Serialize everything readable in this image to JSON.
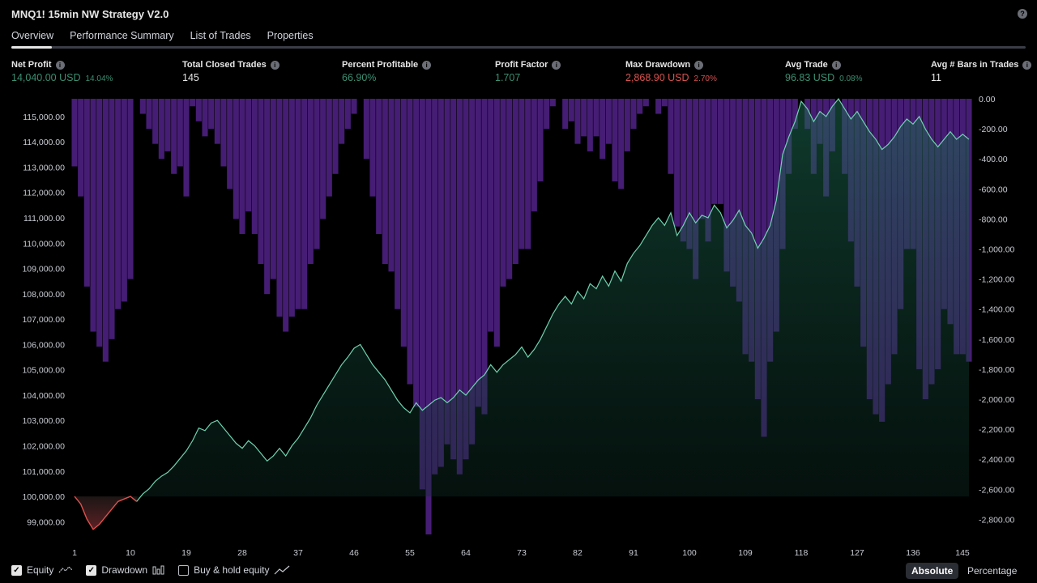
{
  "title": "MNQ1! 15min NW Strategy V2.0",
  "tabs": [
    "Overview",
    "Performance Summary",
    "List of Trades",
    "Properties"
  ],
  "stats": [
    {
      "label": "Net Profit",
      "value": "14,040.00 USD",
      "sub": "14.04%",
      "tone": "green"
    },
    {
      "label": "Total Closed Trades",
      "value": "145",
      "sub": "",
      "tone": "white"
    },
    {
      "label": "Percent Profitable",
      "value": "66.90%",
      "sub": "",
      "tone": "green"
    },
    {
      "label": "Profit Factor",
      "value": "1.707",
      "sub": "",
      "tone": "green"
    },
    {
      "label": "Max Drawdown",
      "value": "2,868.90 USD",
      "sub": "2.70%",
      "tone": "red"
    },
    {
      "label": "Avg Trade",
      "value": "96.83 USD",
      "sub": "0.08%",
      "tone": "green"
    },
    {
      "label": "Avg # Bars in Trades",
      "value": "11",
      "sub": "",
      "tone": "white"
    }
  ],
  "legend": {
    "equity": "Equity",
    "drawdown": "Drawdown",
    "buyhold": "Buy & hold equity"
  },
  "modes": {
    "absolute": "Absolute",
    "percentage": "Percentage"
  },
  "colors": {
    "equity_up": "#6fd3b0",
    "equity_down": "#e0524f",
    "drawdown_bar": "#4a1f7a",
    "accent": "#3c8f72",
    "negative": "#d9524f"
  },
  "chart_data": {
    "type": "area",
    "x_ticks": [
      1,
      10,
      19,
      28,
      37,
      46,
      55,
      64,
      73,
      82,
      91,
      100,
      109,
      118,
      127,
      136,
      145
    ],
    "left_axis": {
      "ylim": [
        98500,
        115700
      ],
      "ticks": [
        "115,000.00",
        "114,000.00",
        "113,000.00",
        "112,000.00",
        "111,000.00",
        "110,000.00",
        "109,000.00",
        "108,000.00",
        "107,000.00",
        "106,000.00",
        "105,000.00",
        "104,000.00",
        "103,000.00",
        "102,000.00",
        "101,000.00",
        "100,000.00",
        "99,000.00"
      ]
    },
    "right_axis": {
      "ylim": [
        -2900,
        0
      ],
      "ticks": [
        "0.00",
        "-200.00",
        "-400.00",
        "-600.00",
        "-800.00",
        "-1,000.00",
        "-1,200.00",
        "-1,400.00",
        "-1,600.00",
        "-1,800.00",
        "-2,000.00",
        "-2,200.00",
        "-2,400.00",
        "-2,600.00",
        "-2,800.00"
      ]
    },
    "baseline": 100000,
    "series": [
      {
        "name": "Equity",
        "points": [
          [
            1,
            100000
          ],
          [
            2,
            99700
          ],
          [
            3,
            99100
          ],
          [
            4,
            98700
          ],
          [
            5,
            98900
          ],
          [
            6,
            99200
          ],
          [
            7,
            99500
          ],
          [
            8,
            99800
          ],
          [
            9,
            99900
          ],
          [
            10,
            100000
          ],
          [
            11,
            99800
          ],
          [
            12,
            100100
          ],
          [
            13,
            100300
          ],
          [
            14,
            100600
          ],
          [
            15,
            100800
          ],
          [
            16,
            100950
          ],
          [
            17,
            101200
          ],
          [
            18,
            101500
          ],
          [
            19,
            101800
          ],
          [
            20,
            102200
          ],
          [
            21,
            102700
          ],
          [
            22,
            102600
          ],
          [
            23,
            102900
          ],
          [
            24,
            103000
          ],
          [
            25,
            102700
          ],
          [
            26,
            102400
          ],
          [
            27,
            102100
          ],
          [
            28,
            101900
          ],
          [
            29,
            102200
          ],
          [
            30,
            102000
          ],
          [
            31,
            101700
          ],
          [
            32,
            101400
          ],
          [
            33,
            101600
          ],
          [
            34,
            101900
          ],
          [
            35,
            101600
          ],
          [
            36,
            102000
          ],
          [
            37,
            102300
          ],
          [
            38,
            102700
          ],
          [
            39,
            103100
          ],
          [
            40,
            103600
          ],
          [
            41,
            104000
          ],
          [
            42,
            104400
          ],
          [
            43,
            104800
          ],
          [
            44,
            105200
          ],
          [
            45,
            105500
          ],
          [
            46,
            105850
          ],
          [
            47,
            106000
          ],
          [
            48,
            105600
          ],
          [
            49,
            105200
          ],
          [
            50,
            104900
          ],
          [
            51,
            104600
          ],
          [
            52,
            104200
          ],
          [
            53,
            103800
          ],
          [
            54,
            103500
          ],
          [
            55,
            103300
          ],
          [
            56,
            103700
          ],
          [
            57,
            103400
          ],
          [
            58,
            103600
          ],
          [
            59,
            103800
          ],
          [
            60,
            103900
          ],
          [
            61,
            103700
          ],
          [
            62,
            103900
          ],
          [
            63,
            104200
          ],
          [
            64,
            104000
          ],
          [
            65,
            104300
          ],
          [
            66,
            104600
          ],
          [
            67,
            104800
          ],
          [
            68,
            105200
          ],
          [
            69,
            104900
          ],
          [
            70,
            105200
          ],
          [
            71,
            105400
          ],
          [
            72,
            105600
          ],
          [
            73,
            105900
          ],
          [
            74,
            105500
          ],
          [
            75,
            105800
          ],
          [
            76,
            106200
          ],
          [
            77,
            106700
          ],
          [
            78,
            107200
          ],
          [
            79,
            107600
          ],
          [
            80,
            107900
          ],
          [
            81,
            107600
          ],
          [
            82,
            108100
          ],
          [
            83,
            107800
          ],
          [
            84,
            108400
          ],
          [
            85,
            108200
          ],
          [
            86,
            108700
          ],
          [
            87,
            108300
          ],
          [
            88,
            108900
          ],
          [
            89,
            108500
          ],
          [
            90,
            109200
          ],
          [
            91,
            109600
          ],
          [
            92,
            109900
          ],
          [
            93,
            110300
          ],
          [
            94,
            110700
          ],
          [
            95,
            111000
          ],
          [
            96,
            110700
          ],
          [
            97,
            111200
          ],
          [
            98,
            110300
          ],
          [
            99,
            110700
          ],
          [
            100,
            111200
          ],
          [
            101,
            110800
          ],
          [
            102,
            111100
          ],
          [
            103,
            111000
          ],
          [
            104,
            111500
          ],
          [
            105,
            111200
          ],
          [
            106,
            110600
          ],
          [
            107,
            110900
          ],
          [
            108,
            111300
          ],
          [
            109,
            110700
          ],
          [
            110,
            110400
          ],
          [
            111,
            109800
          ],
          [
            112,
            110200
          ],
          [
            113,
            110700
          ],
          [
            114,
            111700
          ],
          [
            115,
            113500
          ],
          [
            116,
            114200
          ],
          [
            117,
            114800
          ],
          [
            118,
            115600
          ],
          [
            119,
            115300
          ],
          [
            120,
            114800
          ],
          [
            121,
            115200
          ],
          [
            122,
            115000
          ],
          [
            123,
            115400
          ],
          [
            124,
            115700
          ],
          [
            125,
            115300
          ],
          [
            126,
            114900
          ],
          [
            127,
            115200
          ],
          [
            128,
            114800
          ],
          [
            129,
            114400
          ],
          [
            130,
            114100
          ],
          [
            131,
            113700
          ],
          [
            132,
            113900
          ],
          [
            133,
            114200
          ],
          [
            134,
            114600
          ],
          [
            135,
            114900
          ],
          [
            136,
            114700
          ],
          [
            137,
            115000
          ],
          [
            138,
            114500
          ],
          [
            139,
            114100
          ],
          [
            140,
            113800
          ],
          [
            141,
            114100
          ],
          [
            142,
            114400
          ],
          [
            143,
            114100
          ],
          [
            144,
            114300
          ],
          [
            145,
            114100
          ]
        ]
      },
      {
        "name": "Drawdown",
        "points": [
          [
            1,
            -450
          ],
          [
            2,
            -650
          ],
          [
            3,
            -1250
          ],
          [
            4,
            -1550
          ],
          [
            5,
            -1650
          ],
          [
            6,
            -1750
          ],
          [
            7,
            -1600
          ],
          [
            8,
            -1400
          ],
          [
            9,
            -1350
          ],
          [
            10,
            -1200
          ],
          [
            11,
            0
          ],
          [
            12,
            -100
          ],
          [
            13,
            -200
          ],
          [
            14,
            -300
          ],
          [
            15,
            -400
          ],
          [
            16,
            -350
          ],
          [
            17,
            -500
          ],
          [
            18,
            -450
          ],
          [
            19,
            -650
          ],
          [
            20,
            -50
          ],
          [
            21,
            -150
          ],
          [
            22,
            -250
          ],
          [
            23,
            -200
          ],
          [
            24,
            -300
          ],
          [
            25,
            -450
          ],
          [
            26,
            -600
          ],
          [
            27,
            -800
          ],
          [
            28,
            -900
          ],
          [
            29,
            -750
          ],
          [
            30,
            -900
          ],
          [
            31,
            -1100
          ],
          [
            32,
            -1300
          ],
          [
            33,
            -1200
          ],
          [
            34,
            -1450
          ],
          [
            35,
            -1550
          ],
          [
            36,
            -1450
          ],
          [
            37,
            -1400
          ],
          [
            38,
            -1400
          ],
          [
            39,
            -1100
          ],
          [
            40,
            -1000
          ],
          [
            41,
            -800
          ],
          [
            42,
            -650
          ],
          [
            43,
            -500
          ],
          [
            44,
            -300
          ],
          [
            45,
            -200
          ],
          [
            46,
            -100
          ],
          [
            47,
            0
          ],
          [
            48,
            -400
          ],
          [
            49,
            -650
          ],
          [
            50,
            -900
          ],
          [
            51,
            -1100
          ],
          [
            52,
            -1150
          ],
          [
            53,
            -1400
          ],
          [
            54,
            -1650
          ],
          [
            55,
            -1900
          ],
          [
            56,
            -2050
          ],
          [
            57,
            -2600
          ],
          [
            58,
            -2900
          ],
          [
            59,
            -2500
          ],
          [
            60,
            -2450
          ],
          [
            61,
            -2300
          ],
          [
            62,
            -2400
          ],
          [
            63,
            -2500
          ],
          [
            64,
            -2400
          ],
          [
            65,
            -2300
          ],
          [
            66,
            -2050
          ],
          [
            67,
            -2100
          ],
          [
            68,
            -1550
          ],
          [
            69,
            -1650
          ],
          [
            70,
            -1250
          ],
          [
            71,
            -1200
          ],
          [
            72,
            -1100
          ],
          [
            73,
            -1000
          ],
          [
            74,
            -1000
          ],
          [
            75,
            -750
          ],
          [
            76,
            -550
          ],
          [
            77,
            -200
          ],
          [
            78,
            -50
          ],
          [
            79,
            0
          ],
          [
            80,
            -200
          ],
          [
            81,
            -150
          ],
          [
            82,
            -300
          ],
          [
            83,
            -250
          ],
          [
            84,
            -350
          ],
          [
            85,
            -250
          ],
          [
            86,
            -400
          ],
          [
            87,
            -300
          ],
          [
            88,
            -550
          ],
          [
            89,
            -600
          ],
          [
            90,
            -350
          ],
          [
            91,
            -200
          ],
          [
            92,
            -100
          ],
          [
            93,
            -50
          ],
          [
            94,
            0
          ],
          [
            95,
            -100
          ],
          [
            96,
            -50
          ],
          [
            97,
            -500
          ],
          [
            98,
            -850
          ],
          [
            99,
            -950
          ],
          [
            100,
            -1000
          ],
          [
            101,
            -1200
          ],
          [
            102,
            -800
          ],
          [
            103,
            -950
          ],
          [
            104,
            -700
          ],
          [
            105,
            -700
          ],
          [
            106,
            -1150
          ],
          [
            107,
            -1250
          ],
          [
            108,
            -1350
          ],
          [
            109,
            -1700
          ],
          [
            110,
            -1750
          ],
          [
            111,
            -2000
          ],
          [
            112,
            -2250
          ],
          [
            113,
            -1750
          ],
          [
            114,
            -1550
          ],
          [
            115,
            -1000
          ],
          [
            116,
            -500
          ],
          [
            117,
            -200
          ],
          [
            118,
            0
          ],
          [
            119,
            -200
          ],
          [
            120,
            -500
          ],
          [
            121,
            -300
          ],
          [
            122,
            -650
          ],
          [
            123,
            -350
          ],
          [
            124,
            0
          ],
          [
            125,
            -500
          ],
          [
            126,
            -950
          ],
          [
            127,
            -1250
          ],
          [
            128,
            -1650
          ],
          [
            129,
            -2000
          ],
          [
            130,
            -2100
          ],
          [
            131,
            -2150
          ],
          [
            132,
            -1900
          ],
          [
            133,
            -1700
          ],
          [
            134,
            -1400
          ],
          [
            135,
            -1000
          ],
          [
            136,
            -1000
          ],
          [
            137,
            -1800
          ],
          [
            138,
            -2000
          ],
          [
            139,
            -1900
          ],
          [
            140,
            -1800
          ],
          [
            141,
            -1400
          ],
          [
            142,
            -1500
          ],
          [
            143,
            -1700
          ],
          [
            144,
            -1700
          ],
          [
            145,
            -1750
          ]
        ]
      }
    ]
  }
}
